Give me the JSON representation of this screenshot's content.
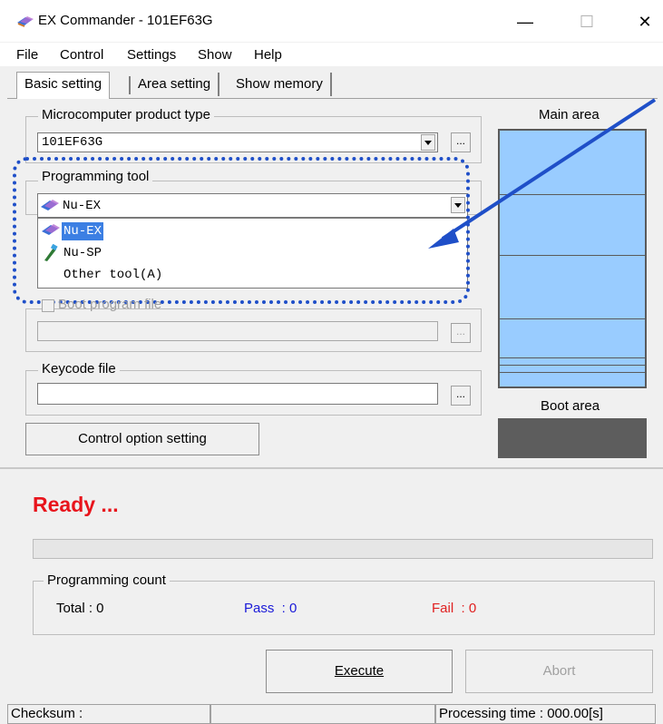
{
  "window": {
    "title": "EX Commander - 101EF63G",
    "minimize": "—",
    "maximize": "☐",
    "close": "✕"
  },
  "menu": [
    "File",
    "Control",
    "Settings",
    "Show",
    "Help"
  ],
  "tabs": [
    "Basic setting",
    "Area setting",
    "Show memory"
  ],
  "product": {
    "label": "Microcomputer product type",
    "value": "101EF63G",
    "button": "..."
  },
  "tool": {
    "label": "Programming tool",
    "value": "Nu-EX",
    "options": [
      "Nu-EX",
      "Nu-SP",
      "Other tool(A)"
    ],
    "selected_index": 0
  },
  "boot": {
    "label": "Boot program file",
    "button": "..."
  },
  "keycode": {
    "label": "Keycode file",
    "button": "..."
  },
  "control_option_button": "Control option setting",
  "memory": {
    "main_label": "Main area",
    "boot_label": "Boot area"
  },
  "status_text": "Ready ...",
  "count": {
    "label": "Programming count",
    "total": "Total : 0",
    "pass": "Pass  : 0",
    "fail": "Fail  : 0"
  },
  "buttons": {
    "execute": "Execute",
    "abort": "Abort"
  },
  "statusbar": {
    "checksum": "Checksum :",
    "processing": "Processing time :  000.00[s]"
  },
  "colors": {
    "memory_fill": "#99ccff",
    "boot_fill": "#5d5d5d",
    "ready_red": "#e8141c",
    "pass_blue": "#1a1ad8",
    "fail_red": "#e02020",
    "callout_blue": "#1f4fc8",
    "selection_blue": "#3c7fe3"
  }
}
